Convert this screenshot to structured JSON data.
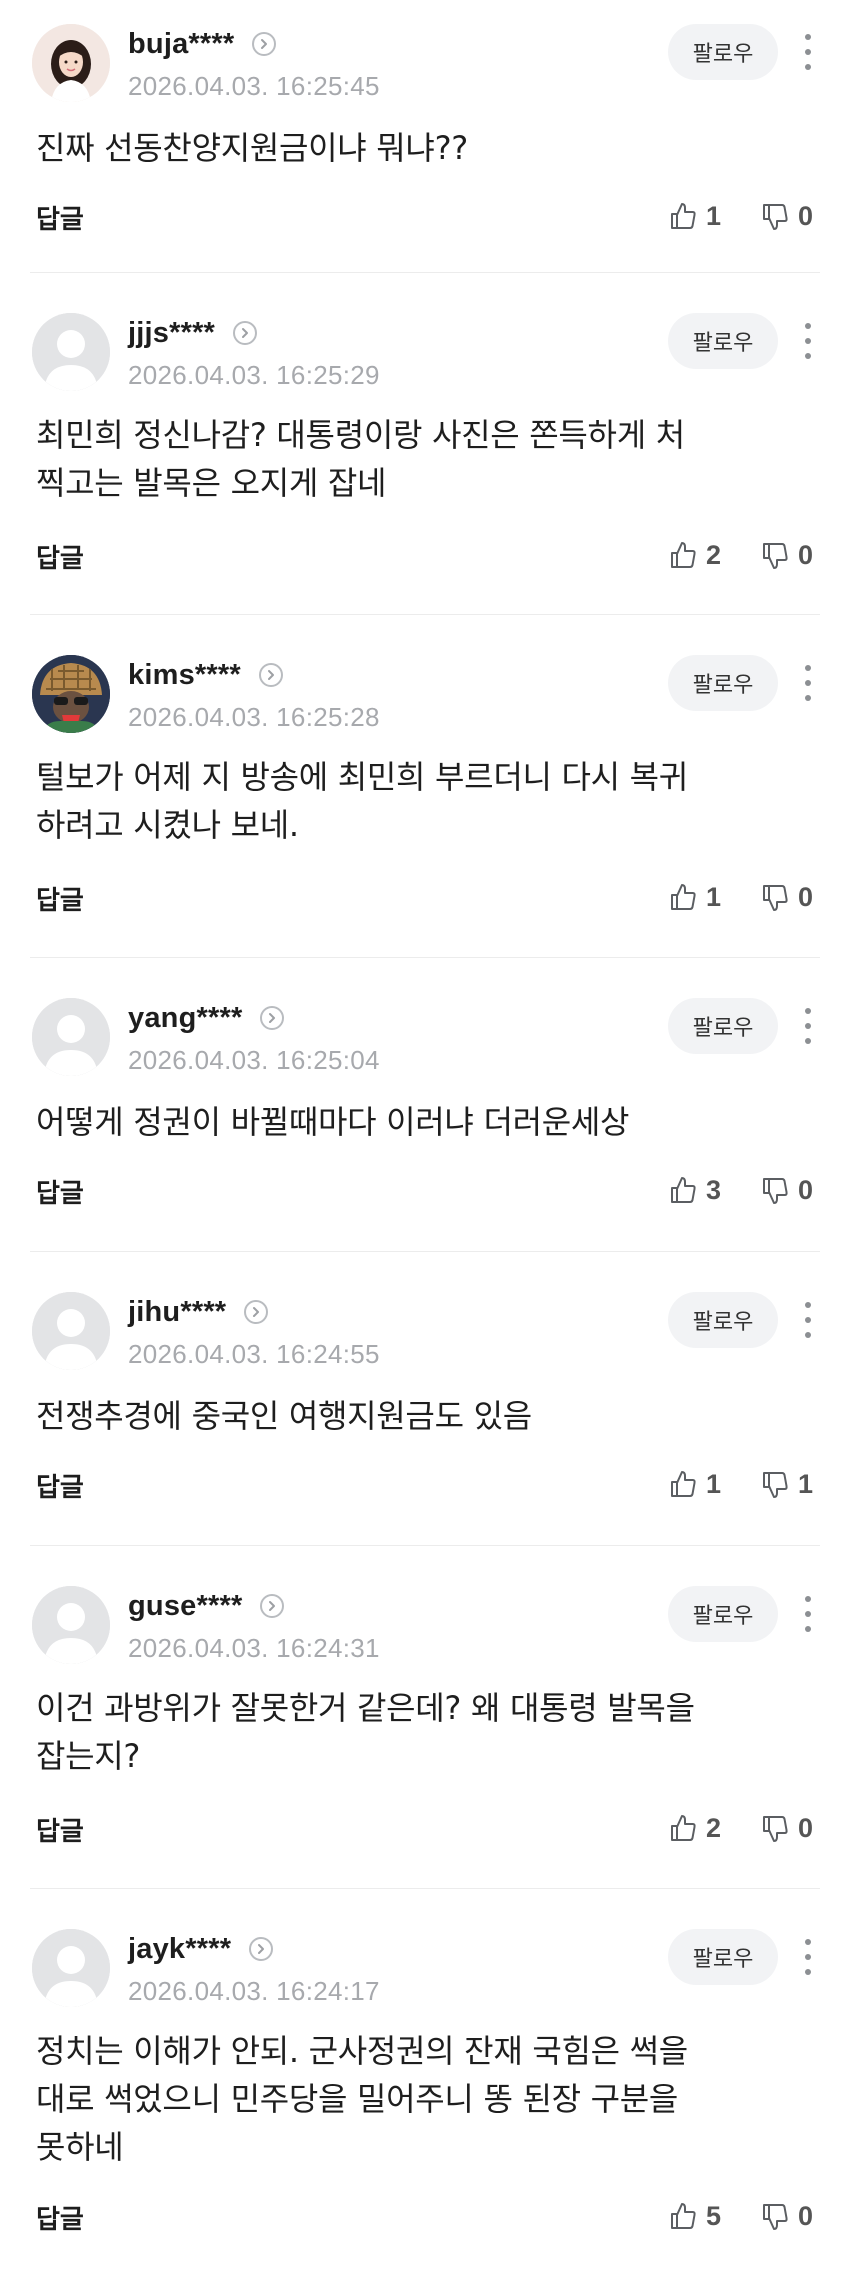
{
  "follow_label": "팔로우",
  "reply_label": "답글",
  "comments": [
    {
      "username": "buja****",
      "timestamp": "2026.04.03. 16:25:45",
      "avatar": "profile-photo",
      "content": "진짜 선동찬양지원금이냐 뭐냐??",
      "likes": "1",
      "dislikes": "0"
    },
    {
      "username": "jjjs****",
      "timestamp": "2026.04.03. 16:25:29",
      "avatar": "default-avatar",
      "content": "최민희 정신나감? 대통령이랑 사진은 쫀득하게 처\n찍고는 발목은 오지게 잡네",
      "likes": "2",
      "dislikes": "0"
    },
    {
      "username": "kims****",
      "timestamp": "2026.04.03. 16:25:28",
      "avatar": "character-avatar",
      "content": "털보가 어제 지 방송에 최민희 부르더니 다시 복귀\n하려고 시켰나 보네.",
      "likes": "1",
      "dislikes": "0"
    },
    {
      "username": "yang****",
      "timestamp": "2026.04.03. 16:25:04",
      "avatar": "default-avatar",
      "content": "어떻게 정권이 바뀔때마다 이러냐 더러운세상",
      "likes": "3",
      "dislikes": "0"
    },
    {
      "username": "jihu****",
      "timestamp": "2026.04.03. 16:24:55",
      "avatar": "default-avatar",
      "content": "전쟁추경에 중국인 여행지원금도 있음",
      "likes": "1",
      "dislikes": "1"
    },
    {
      "username": "guse****",
      "timestamp": "2026.04.03. 16:24:31",
      "avatar": "default-avatar",
      "content": "이건 과방위가 잘못한거 같은데? 왜 대통령 발목을\n잡는지?",
      "likes": "2",
      "dislikes": "0"
    },
    {
      "username": "jayk****",
      "timestamp": "2026.04.03. 16:24:17",
      "avatar": "default-avatar",
      "content": "정치는 이해가 안되. 군사정권의 잔재 국힘은 썩을\n대로 썩었으니 민주당을 밀어주니 똥 된장 구분을\n못하네",
      "likes": "5",
      "dislikes": "0"
    }
  ]
}
